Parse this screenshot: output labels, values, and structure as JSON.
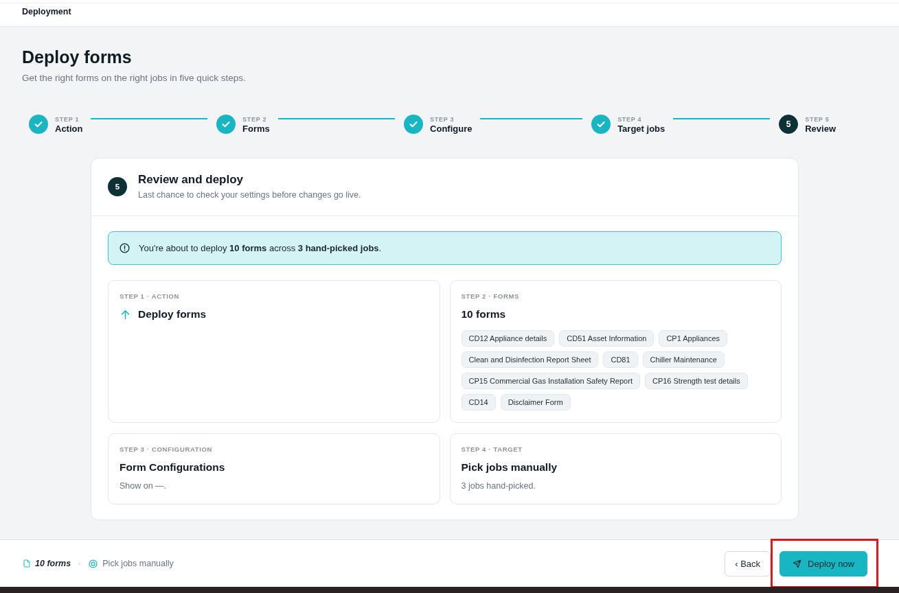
{
  "header": {
    "title": "Deployment"
  },
  "page": {
    "title": "Deploy forms",
    "subtitle": "Get the right forms on the right jobs in five quick steps."
  },
  "stepper": [
    {
      "step_label": "STEP 1",
      "name": "Action",
      "completed": true,
      "selected": false
    },
    {
      "step_label": "STEP 2",
      "name": "Forms",
      "completed": true,
      "selected": false
    },
    {
      "step_label": "STEP 3",
      "name": "Configure",
      "completed": true,
      "selected": false
    },
    {
      "step_label": "STEP 4",
      "name": "Target jobs",
      "completed": true,
      "selected": false
    },
    {
      "step_label": "STEP 5",
      "name": "Review",
      "number": "5",
      "completed": false,
      "selected": true
    }
  ],
  "review": {
    "number": "5",
    "title": "Review and deploy",
    "subtitle": "Last chance to check your settings before changes go live.",
    "banner": "You're about to deploy **10 forms** across **3 hand-picked jobs**.",
    "cards": [
      {
        "kind": "action",
        "label": "STEP 1 · ACTION",
        "title": "Deploy forms"
      },
      {
        "kind": "chips",
        "label": "STEP 2 · FORMS",
        "title": "10 forms",
        "chips": [
          "CD12 Appliance details",
          "CD51 Asset Information",
          "CP1 Appliances",
          "Clean and Disinfection Report Sheet",
          "CD81",
          "Chiller Maintenance",
          "CP15 Commercial Gas Installation Safety Report",
          "CP16 Strength test details",
          "CD14",
          "Disclaimer Form"
        ]
      },
      {
        "kind": "text",
        "label": "STEP 3 · CONFIGURATION",
        "title": "Form Configurations",
        "note": "Show on —."
      },
      {
        "kind": "text",
        "label": "STEP 4 · TARGET",
        "title": "Pick jobs manually",
        "note": "3 jobs hand-picked."
      }
    ]
  },
  "footer": {
    "summary": [
      {
        "kind": "forms",
        "text": "10 forms"
      },
      {
        "kind": "target",
        "text": "Pick jobs manually"
      }
    ],
    "separator": "·",
    "buttons": [
      {
        "kind": "back",
        "label": "‹ Back",
        "highlighted": false
      },
      {
        "kind": "primary",
        "label": "Deploy now",
        "highlighted": true
      }
    ]
  }
}
